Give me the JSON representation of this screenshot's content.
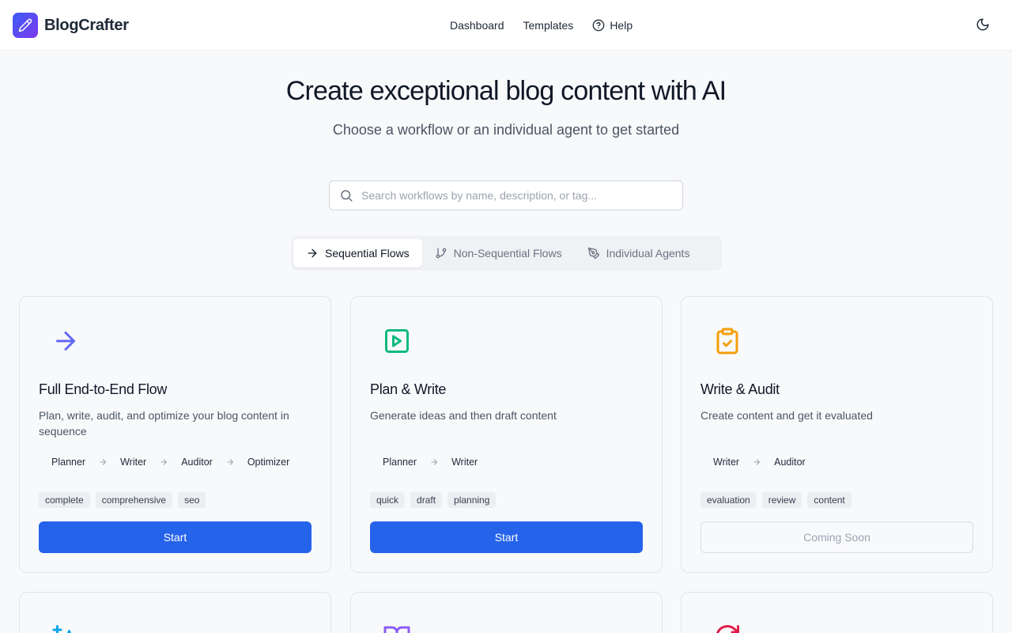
{
  "brand": {
    "name": "BlogCrafter",
    "logo_icon": "pencil-icon",
    "accent": "#2563eb"
  },
  "nav": [
    {
      "label": "Dashboard"
    },
    {
      "label": "Templates"
    },
    {
      "label": "Help",
      "icon": "help-circle-icon"
    }
  ],
  "theme_toggle": {
    "icon": "moon-icon"
  },
  "hero": {
    "title": "Create exceptional blog content with AI",
    "subtitle": "Choose a workflow or an individual agent to get started"
  },
  "search": {
    "placeholder": "Search workflows by name, description, or tag...",
    "value": ""
  },
  "tabs": [
    {
      "label": "Sequential Flows",
      "icon": "arrow-right-icon",
      "active": true
    },
    {
      "label": "Non-Sequential Flows",
      "icon": "git-branch-icon",
      "active": false
    },
    {
      "label": "Individual Agents",
      "icon": "pen-tool-icon",
      "active": false
    }
  ],
  "cards": [
    {
      "icon": "arrow-right-icon",
      "icon_color": "#6366f1",
      "title": "Full End-to-End Flow",
      "description": "Plan, write, audit, and optimize your blog content in sequence",
      "steps": [
        "Planner",
        "Writer",
        "Auditor",
        "Optimizer"
      ],
      "tags": [
        "complete",
        "comprehensive",
        "seo"
      ],
      "button": "Start",
      "enabled": true
    },
    {
      "icon": "play-square-icon",
      "icon_color": "#10b981",
      "title": "Plan & Write",
      "description": "Generate ideas and then draft content",
      "steps": [
        "Planner",
        "Writer"
      ],
      "tags": [
        "quick",
        "draft",
        "planning"
      ],
      "button": "Start",
      "enabled": true
    },
    {
      "icon": "clipboard-check-icon",
      "icon_color": "#f59e0b",
      "title": "Write & Audit",
      "description": "Create content and get it evaluated",
      "steps": [
        "Writer",
        "Auditor"
      ],
      "tags": [
        "evaluation",
        "review",
        "content"
      ],
      "button": "Coming Soon",
      "enabled": false
    },
    {
      "icon": "sparkle-text-icon",
      "icon_color": "#0ea5e9"
    },
    {
      "icon": "book-open-icon",
      "icon_color": "#8b5cf6"
    },
    {
      "icon": "refresh-icon",
      "icon_color": "#e11d48"
    }
  ]
}
